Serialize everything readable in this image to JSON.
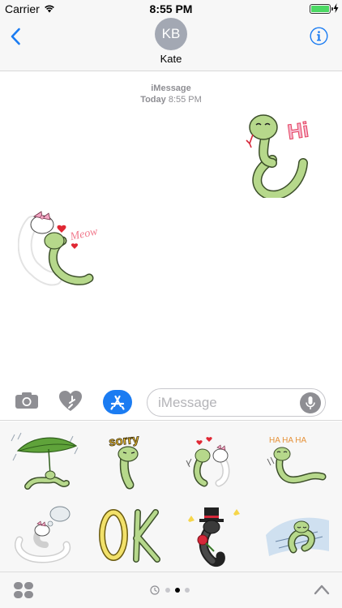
{
  "status_bar": {
    "carrier": "Carrier",
    "time": "8:55 PM",
    "battery_level": 1.0
  },
  "header": {
    "back_icon": "chevron-left-icon",
    "avatar_initials": "KB",
    "contact_name": "Kate",
    "info_icon": "info-circle-icon"
  },
  "conversation": {
    "service": "iMessage",
    "day": "Today",
    "time": "8:55 PM",
    "messages": [
      {
        "sender": "me",
        "type": "sticker",
        "sticker": "snake-hi",
        "text": "Hi"
      },
      {
        "sender": "Kate",
        "type": "sticker",
        "sticker": "snake-meow",
        "text": "Meow"
      }
    ]
  },
  "input_bar": {
    "placeholder": "iMessage",
    "value": "",
    "icons": [
      "camera-icon",
      "digital-touch-icon",
      "app-store-icon",
      "microphone-icon"
    ]
  },
  "sticker_drawer": {
    "stickers": [
      {
        "name": "snake-leaf-rain"
      },
      {
        "name": "snake-sorry",
        "label": "sorry"
      },
      {
        "name": "snake-love-couple"
      },
      {
        "name": "snake-ha-ha-ha",
        "label": "HA HA HA"
      },
      {
        "name": "snake-sigh"
      },
      {
        "name": "snake-ok",
        "label": "OK"
      },
      {
        "name": "snake-top-hat-rose"
      },
      {
        "name": "snake-sleeping"
      }
    ]
  },
  "bottom_bar": {
    "pages": 3,
    "current_page": 2,
    "icons": [
      "apps-grid-icon",
      "recents-clock-icon",
      "chevron-up-icon"
    ]
  },
  "colors": {
    "accent": "#1b7cf2",
    "snake_green": "#b6d88b",
    "snake_outline": "#3c4f2a",
    "battery": "#4cd964",
    "avatar": "#a3a8b3"
  }
}
